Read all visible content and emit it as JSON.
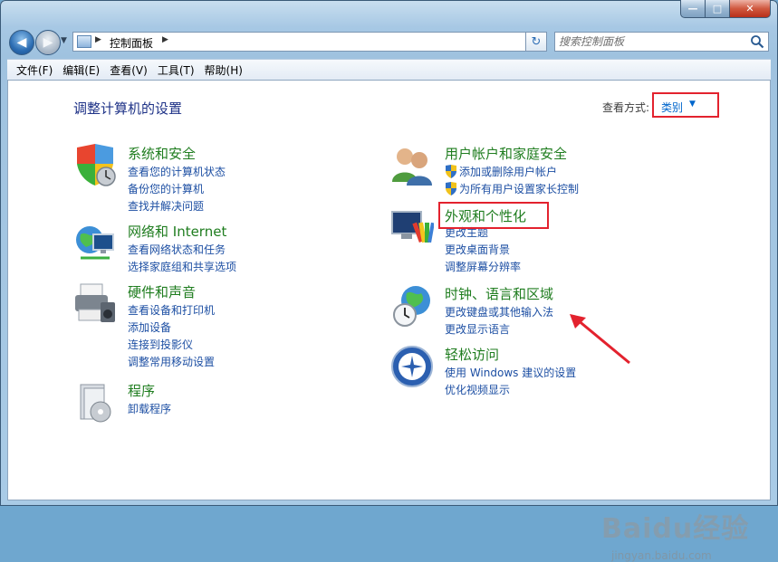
{
  "window": {
    "caption_buttons": {
      "minimize": "—",
      "maximize": "□",
      "close": "✕"
    }
  },
  "nav": {
    "address_crumb": "控制面板",
    "search_placeholder": "搜索控制面板",
    "icons": [
      "back-arrow-icon",
      "forward-arrow-icon",
      "control-panel-icon",
      "refresh-icon",
      "search-icon"
    ]
  },
  "menu": {
    "items": [
      "文件(F)",
      "编辑(E)",
      "查看(V)",
      "工具(T)",
      "帮助(H)"
    ]
  },
  "main": {
    "title": "调整计算机的设置",
    "view_mode_label": "查看方式:",
    "view_mode_value": "类别"
  },
  "categories": {
    "system": {
      "title": "系统和安全",
      "links": [
        "查看您的计算机状态",
        "备份您的计算机",
        "查找并解决问题"
      ]
    },
    "network": {
      "title": "网络和 Internet",
      "links": [
        "查看网络状态和任务",
        "选择家庭组和共享选项"
      ]
    },
    "hardware": {
      "title": "硬件和声音",
      "links": [
        "查看设备和打印机",
        "添加设备",
        "连接到投影仪",
        "调整常用移动设置"
      ]
    },
    "programs": {
      "title": "程序",
      "links": [
        "卸载程序"
      ]
    },
    "users": {
      "title": "用户帐户和家庭安全",
      "links": [
        "添加或删除用户帐户",
        "为所有用户设置家长控制"
      ]
    },
    "appearance": {
      "title": "外观和个性化",
      "links": [
        "更改主题",
        "更改桌面背景",
        "调整屏幕分辨率"
      ]
    },
    "clock": {
      "title": "时钟、语言和区域",
      "links": [
        "更改键盘或其他输入法",
        "更改显示语言"
      ]
    },
    "access": {
      "title": "轻松访问",
      "links": [
        "使用 Windows 建议的设置",
        "优化视频显示"
      ]
    }
  },
  "watermark": {
    "brand": "Baidu经验",
    "url": "jingyan.baidu.com"
  },
  "colors": {
    "category_title": "#1f7d1f",
    "link": "#1d4fa3",
    "heading": "#1e3287",
    "highlight": "#e3222e"
  }
}
